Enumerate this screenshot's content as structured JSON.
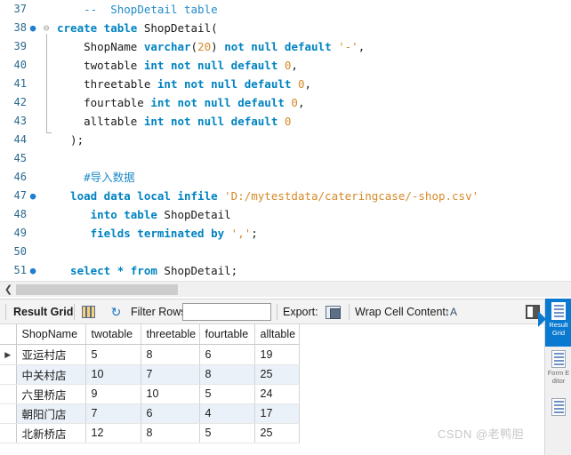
{
  "editor": {
    "lines": [
      {
        "num": "37",
        "marker": "",
        "fold": "",
        "tokens": [
          {
            "t": "    ",
            "c": "plain"
          },
          {
            "t": "--  ShopDetail table",
            "c": "cmt"
          }
        ]
      },
      {
        "num": "38",
        "marker": "●",
        "fold": "⊖",
        "tokens": [
          {
            "t": "create table ",
            "c": "kw"
          },
          {
            "t": "ShopDetail(",
            "c": "plain"
          }
        ]
      },
      {
        "num": "39",
        "marker": "",
        "fold": "",
        "tokens": [
          {
            "t": "    ShopName ",
            "c": "plain"
          },
          {
            "t": "varchar",
            "c": "kw"
          },
          {
            "t": "(",
            "c": "plain"
          },
          {
            "t": "20",
            "c": "num"
          },
          {
            "t": ") ",
            "c": "plain"
          },
          {
            "t": "not null default ",
            "c": "kw"
          },
          {
            "t": "'-'",
            "c": "str"
          },
          {
            "t": ",",
            "c": "plain"
          }
        ]
      },
      {
        "num": "40",
        "marker": "",
        "fold": "",
        "tokens": [
          {
            "t": "    twotable ",
            "c": "plain"
          },
          {
            "t": "int not null default ",
            "c": "kw"
          },
          {
            "t": "0",
            "c": "num"
          },
          {
            "t": ",",
            "c": "plain"
          }
        ]
      },
      {
        "num": "41",
        "marker": "",
        "fold": "",
        "tokens": [
          {
            "t": "    threetable ",
            "c": "plain"
          },
          {
            "t": "int not null default ",
            "c": "kw"
          },
          {
            "t": "0",
            "c": "num"
          },
          {
            "t": ",",
            "c": "plain"
          }
        ]
      },
      {
        "num": "42",
        "marker": "",
        "fold": "",
        "tokens": [
          {
            "t": "    fourtable ",
            "c": "plain"
          },
          {
            "t": "int not null default ",
            "c": "kw"
          },
          {
            "t": "0",
            "c": "num"
          },
          {
            "t": ",",
            "c": "plain"
          }
        ]
      },
      {
        "num": "43",
        "marker": "",
        "fold": "",
        "tokens": [
          {
            "t": "    alltable ",
            "c": "plain"
          },
          {
            "t": "int not null default ",
            "c": "kw"
          },
          {
            "t": "0",
            "c": "num"
          }
        ]
      },
      {
        "num": "44",
        "marker": "",
        "fold": "",
        "tokens": [
          {
            "t": "  );",
            "c": "plain"
          }
        ]
      },
      {
        "num": "45",
        "marker": "",
        "fold": "",
        "tokens": [
          {
            "t": "",
            "c": "plain"
          }
        ]
      },
      {
        "num": "46",
        "marker": "",
        "fold": "",
        "tokens": [
          {
            "t": "    ",
            "c": "plain"
          },
          {
            "t": "#导入数据",
            "c": "cmt"
          }
        ]
      },
      {
        "num": "47",
        "marker": "●",
        "fold": "",
        "tokens": [
          {
            "t": "  load data local infile ",
            "c": "kw"
          },
          {
            "t": "'D:/mytestdata/cateringcase/-shop.csv'",
            "c": "str"
          }
        ]
      },
      {
        "num": "48",
        "marker": "",
        "fold": "",
        "tokens": [
          {
            "t": "     into table ",
            "c": "kw"
          },
          {
            "t": "ShopDetail",
            "c": "plain"
          }
        ]
      },
      {
        "num": "49",
        "marker": "",
        "fold": "",
        "tokens": [
          {
            "t": "     fields terminated by ",
            "c": "kw"
          },
          {
            "t": "','",
            "c": "str"
          },
          {
            "t": ";",
            "c": "plain"
          }
        ]
      },
      {
        "num": "50",
        "marker": "",
        "fold": "",
        "tokens": [
          {
            "t": "",
            "c": "plain"
          }
        ]
      },
      {
        "num": "51",
        "marker": "●",
        "fold": "",
        "tokens": [
          {
            "t": "  select * from ",
            "c": "kw"
          },
          {
            "t": "ShopDetail;",
            "c": "plain"
          }
        ]
      }
    ]
  },
  "scrollbar": {
    "left_chevron": "❮"
  },
  "result_toolbar": {
    "result_grid_label": "Result Grid",
    "grid_icon": "grid-icon",
    "refresh_icon": "↻",
    "filter_rows_label": "Filter Rows:",
    "filter_rows_value": "",
    "filter_rows_placeholder": "",
    "export_label": "Export:",
    "export_icon": "export-disk-icon",
    "wrap_cell_label": "Wrap Cell Content:",
    "wrap_cell_icon": "↕A",
    "panel_toggle_icon": "panel-toggle-icon"
  },
  "result_grid": {
    "columns": [
      "ShopName",
      "twotable",
      "threetable",
      "fourtable",
      "alltable"
    ],
    "rows": [
      {
        "selected": true,
        "cells": [
          "亚运村店",
          "5",
          "8",
          "6",
          "19"
        ]
      },
      {
        "selected": false,
        "cells": [
          "中关村店",
          "10",
          "7",
          "8",
          "25"
        ]
      },
      {
        "selected": false,
        "cells": [
          "六里桥店",
          "9",
          "10",
          "5",
          "24"
        ]
      },
      {
        "selected": false,
        "cells": [
          "朝阳门店",
          "7",
          "6",
          "4",
          "17"
        ]
      },
      {
        "selected": false,
        "cells": [
          "北新桥店",
          "12",
          "8",
          "5",
          "25"
        ]
      }
    ],
    "row_selector_arrow": "▶"
  },
  "side_panel": {
    "tabs": [
      {
        "label": "Result\nGrid",
        "active": true
      },
      {
        "label": "Form\nEditor",
        "active": false
      },
      {
        "label": "",
        "active": false
      }
    ]
  },
  "watermark": {
    "text": "CSDN @老鸭胆"
  },
  "colors": {
    "accent": "#0a7ad1",
    "keyword": "#0083c1",
    "string": "#d48a28",
    "comment": "#1f8bc7",
    "gutter": "#2b6a8f",
    "row_alt": "#eaf1f8"
  }
}
